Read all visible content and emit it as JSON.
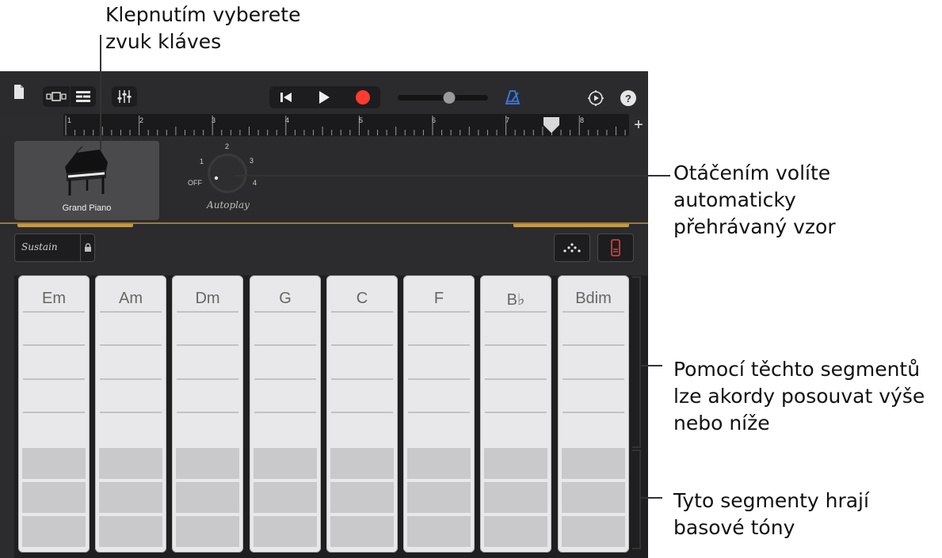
{
  "callouts": {
    "sound": "Klepnutím vyberete\nzvuk kláves",
    "autoplay": "Otáčením volíte\nautomaticky\npřehrávaný vzor",
    "chord_segments": "Pomocí těchto segmentů\nlze akordy posouvat výše\nnebo níže",
    "bass_segments": "Tyto segmenty hrají\nbasové tóny"
  },
  "toolbar": {
    "icons": [
      "document-icon",
      "view-toggle-icon",
      "tracks-view-icon",
      "mixer-icon",
      "rewind-icon",
      "play-icon",
      "record-icon",
      "volume-slider",
      "metronome-icon",
      "settings-icon",
      "help-icon"
    ],
    "help_label": "?",
    "record_color": "#ff3b30",
    "metronome_color": "#2f7fff"
  },
  "ruler": {
    "bars": [
      "1",
      "2",
      "3",
      "4",
      "5",
      "6",
      "7",
      "8"
    ],
    "add_label": "+"
  },
  "instrument": {
    "name": "Grand Piano"
  },
  "autoplay": {
    "positions": [
      "OFF",
      "1",
      "2",
      "3",
      "4"
    ],
    "label": "Autoplay",
    "value": "OFF"
  },
  "controls": {
    "sustain_label": "Sustain"
  },
  "chords": [
    "Em",
    "Am",
    "Dm",
    "G",
    "C",
    "F",
    "B♭",
    "Bdim"
  ],
  "accent_gold": "#c49a48"
}
